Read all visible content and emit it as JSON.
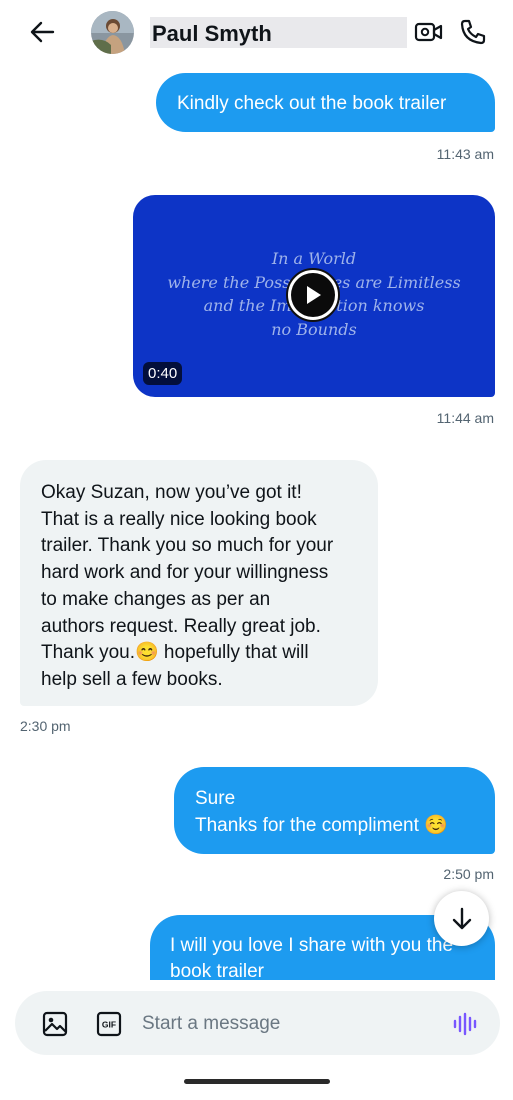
{
  "header": {
    "contact_name": "Paul Smyth",
    "back_icon": "arrow-left-icon",
    "video_icon": "video-call-icon",
    "phone_icon": "phone-call-icon"
  },
  "messages": {
    "m1": {
      "text": "Kindly check out the book trailer",
      "time": "11:43 am"
    },
    "video": {
      "overlay_lines": [
        "In a World",
        "where the Possibilities are Limitless",
        "and the Imagination knows",
        "no Bounds"
      ],
      "duration": "0:40",
      "time": "11:44 am"
    },
    "m2": {
      "lines": [
        "Okay Suzan, now you’ve got it!",
        "That is a really nice looking book",
        "trailer. Thank you so much for your",
        "hard work and for your willingness",
        "to make changes as per an",
        "authors request. Really great job.",
        "Thank you.😊 hopefully that will",
        "help sell a few books."
      ],
      "time": "2:30 pm"
    },
    "m3": {
      "lines": [
        "Sure",
        "Thanks for the compliment ☺️"
      ],
      "time": "2:50 pm"
    },
    "m4": {
      "lines": [
        "I will you love I share with you the",
        "book trailer"
      ]
    }
  },
  "composer": {
    "placeholder": "Start a message",
    "gif_label": "GIF"
  },
  "colors": {
    "accent": "#1d9bf0",
    "incoming_bubble": "#eff3f4",
    "video_bg": "#0d34c6",
    "voice_icon": "#7856ff"
  }
}
